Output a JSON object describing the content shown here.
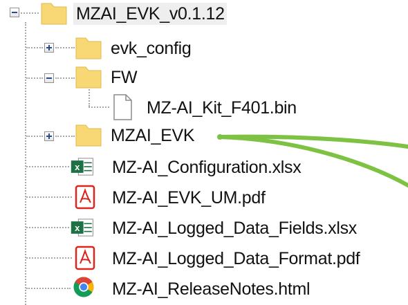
{
  "tree": {
    "root": {
      "label": "MZAI_EVK_v0.1.12",
      "expanded": true,
      "icon": "folder-icon"
    },
    "children": [
      {
        "label": "evk_config",
        "icon": "folder-icon",
        "expander": "collapsed"
      },
      {
        "label": "FW",
        "icon": "folder-icon",
        "expander": "expanded",
        "children": [
          {
            "label": "MZ-AI_Kit_F401.bin",
            "icon": "generic-file-icon"
          }
        ]
      },
      {
        "label": "MZAI_EVK",
        "icon": "folder-icon",
        "expander": "collapsed"
      },
      {
        "label": "MZ-AI_Configuration.xlsx",
        "icon": "excel-file-icon"
      },
      {
        "label": "MZ-AI_EVK_UM.pdf",
        "icon": "pdf-file-icon"
      },
      {
        "label": "MZ-AI_Logged_Data_Fields.xlsx",
        "icon": "excel-file-icon"
      },
      {
        "label": "MZ-AI_Logged_Data_Format.pdf",
        "icon": "pdf-file-icon"
      },
      {
        "label": "MZ-AI_ReleaseNotes.html",
        "icon": "chrome-html-file-icon"
      }
    ]
  },
  "colors": {
    "folder": "#f8d775",
    "excel": "#1e7145",
    "pdf": "#d9251c",
    "annotation": "#7dc242"
  }
}
